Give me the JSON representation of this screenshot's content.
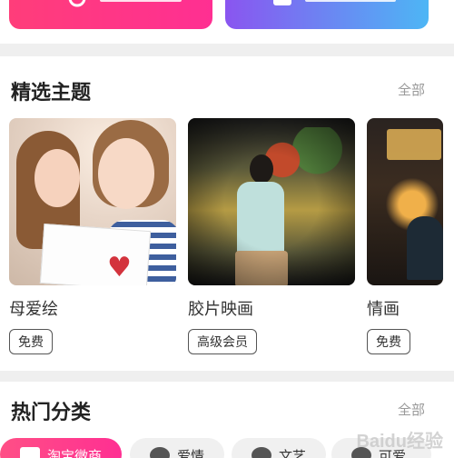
{
  "top_buttons": [
    {
      "icon": "camera-icon",
      "color": "#ff2f92"
    },
    {
      "icon": "video-icon",
      "color": "#4db6f5"
    }
  ],
  "featured": {
    "title": "精选主题",
    "more": "全部",
    "cards": [
      {
        "title": "母爱绘",
        "tag": "免费"
      },
      {
        "title": "胶片映画",
        "tag": "高级会员"
      },
      {
        "title": "情画",
        "tag": "免费"
      }
    ]
  },
  "hot": {
    "title": "热门分类",
    "more": "全部",
    "chips": [
      {
        "label": "淘宝微商",
        "icon": "shirt-icon",
        "active": true
      },
      {
        "label": "爱情",
        "icon": "hearts-icon",
        "active": false
      },
      {
        "label": "文艺",
        "icon": "palette-icon",
        "active": false
      },
      {
        "label": "可爱",
        "icon": "smile-icon",
        "active": false
      }
    ]
  },
  "watermark": "Baidu经验",
  "colors": {
    "accent": "#ff2f92",
    "accent2": "#4db6f5",
    "section_bg": "#ffffff",
    "page_bg": "#efefef"
  }
}
